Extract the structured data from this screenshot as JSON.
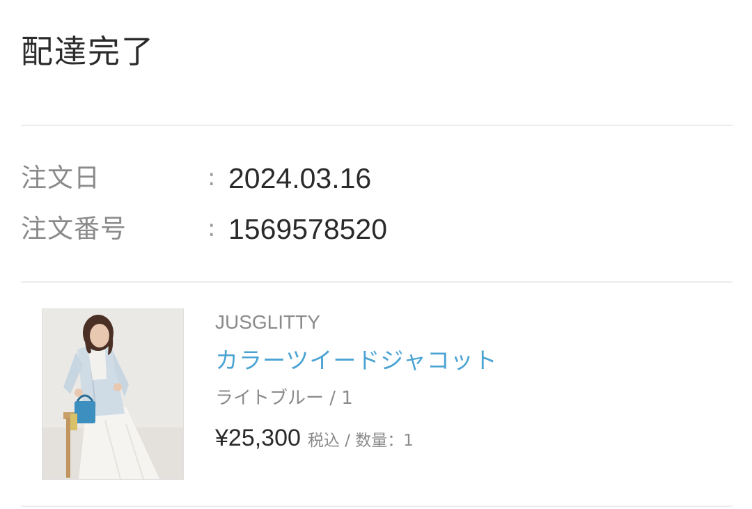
{
  "status": {
    "title": "配達完了"
  },
  "order": {
    "date_label": "注文日",
    "date_colon": ":",
    "date_value": "2024.03.16",
    "number_label": "注文番号",
    "number_colon": ":",
    "number_value": "1569578520"
  },
  "item": {
    "brand": "JUSGLITTY",
    "name": "カラーツイードジャコット",
    "variant": "ライトブルー / 1",
    "price": "¥25,300",
    "meta": "税込 / 数量：1",
    "colors": {
      "link": "#4aa3d3",
      "muted": "#8a8a8a",
      "text": "#2a2a2a"
    }
  }
}
